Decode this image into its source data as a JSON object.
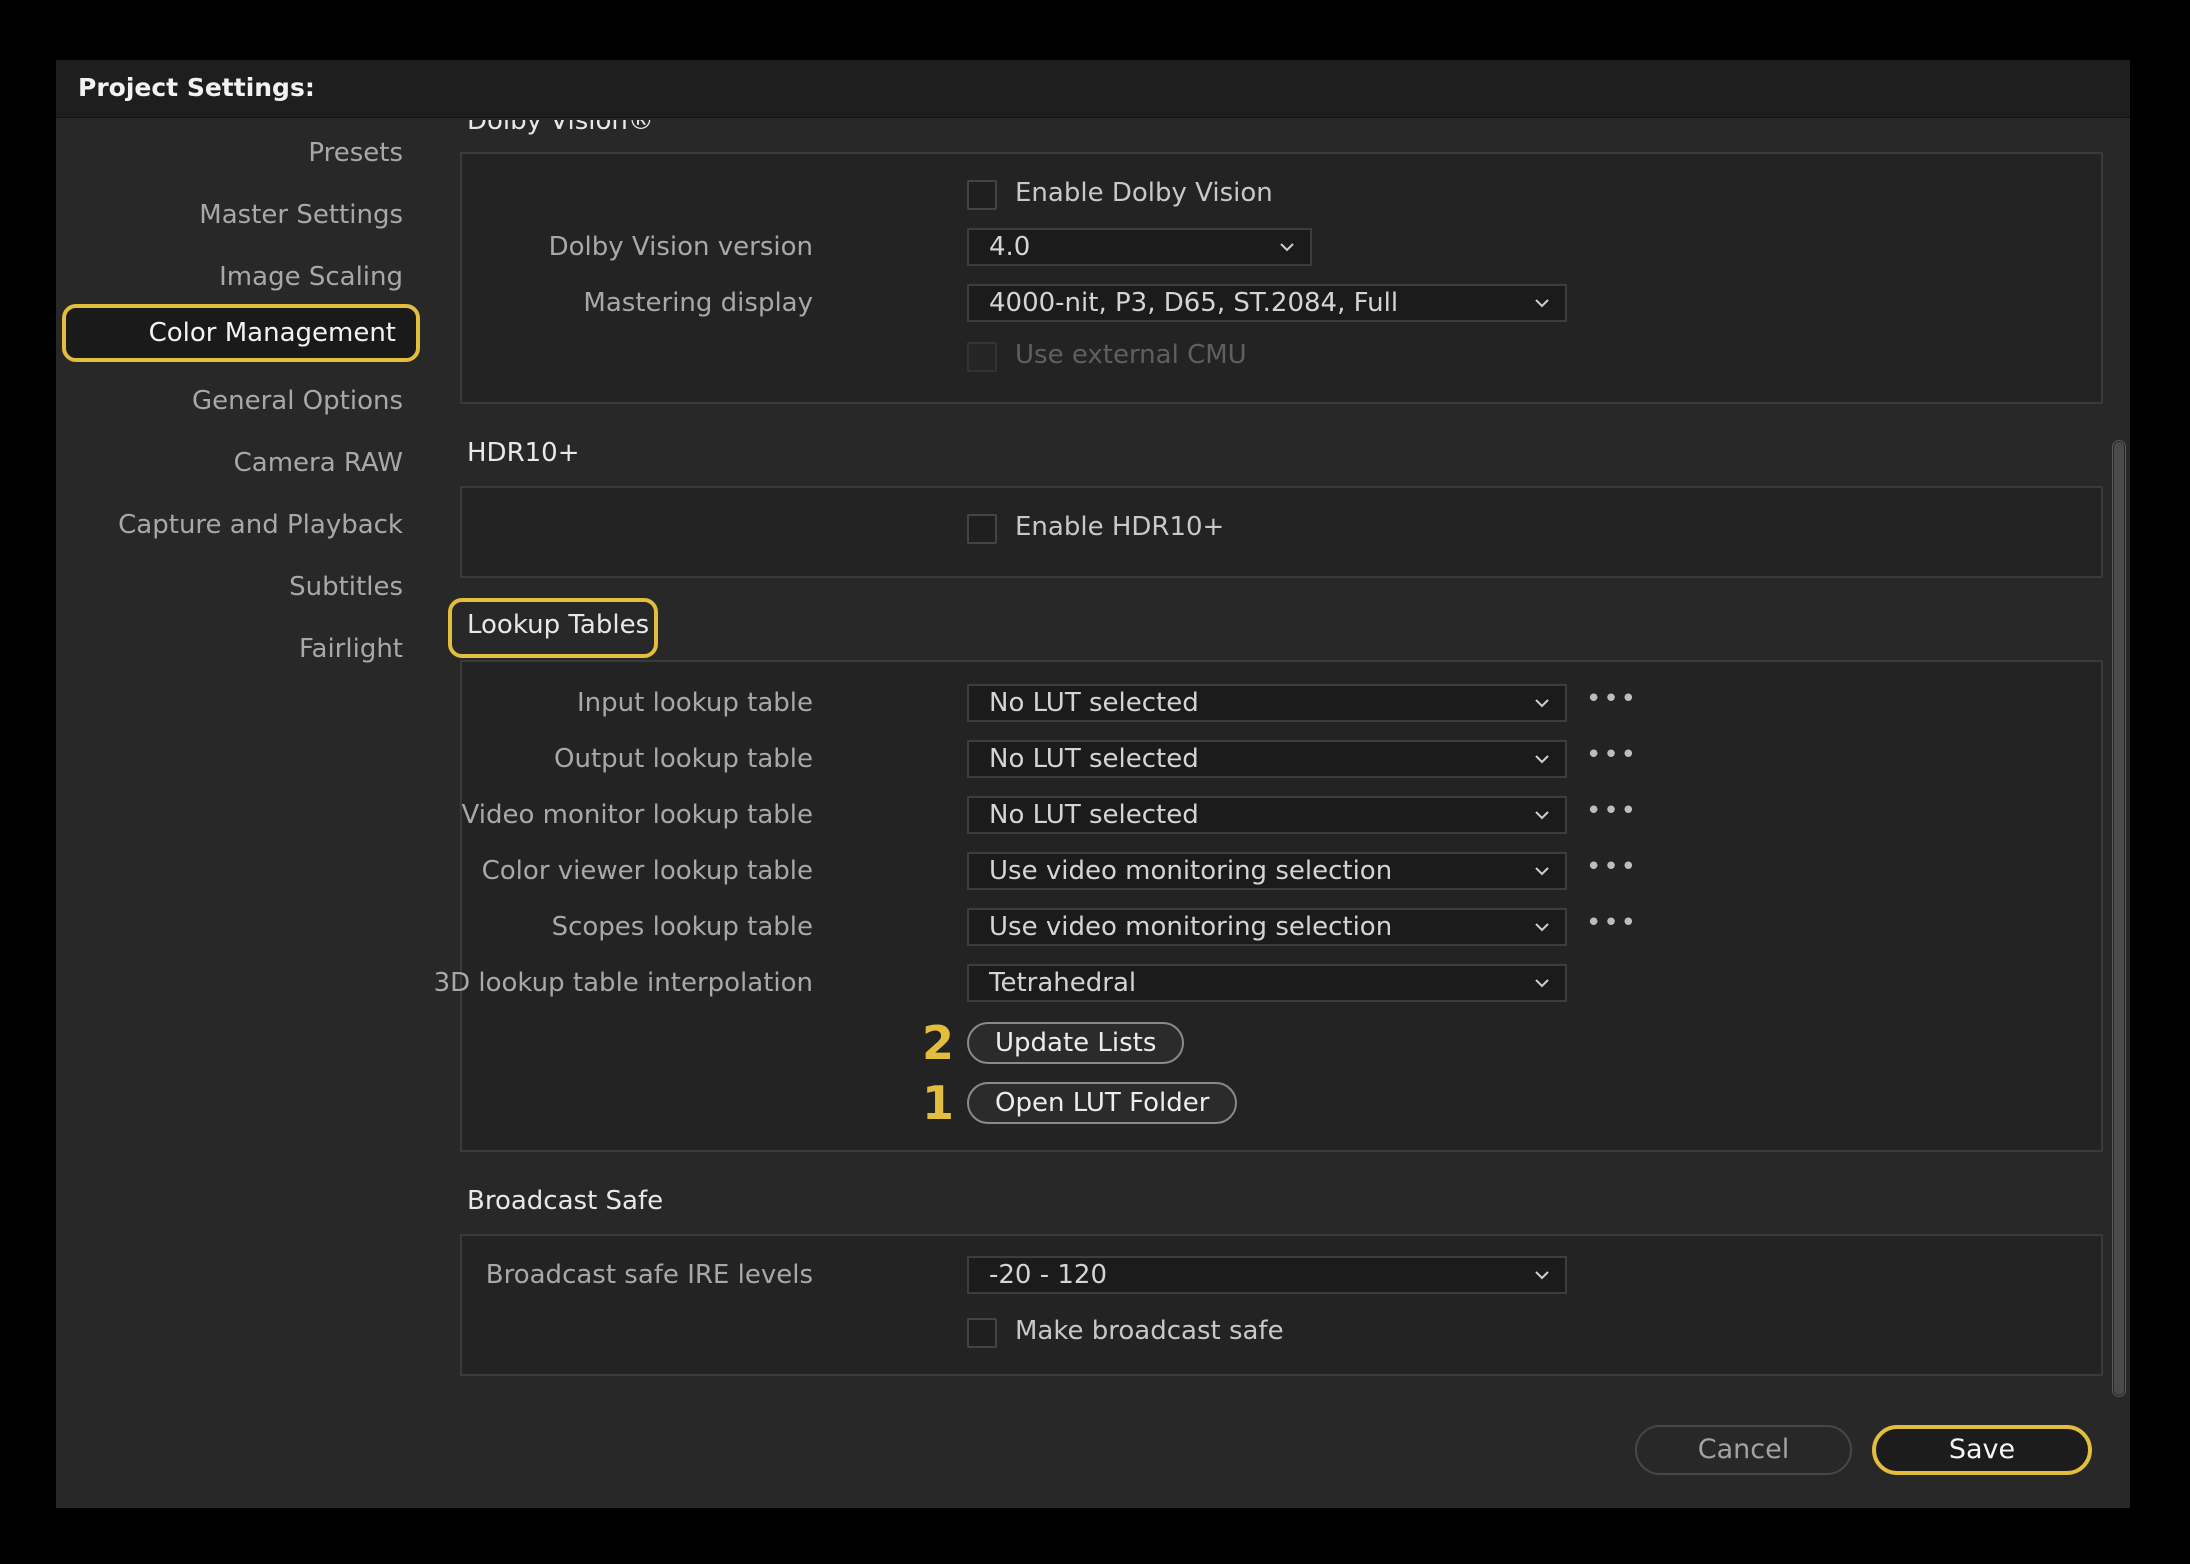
{
  "window": {
    "title": "Project Settings:"
  },
  "sidebar": {
    "items": [
      {
        "label": "Presets"
      },
      {
        "label": "Master Settings"
      },
      {
        "label": "Image Scaling"
      },
      {
        "label": "Color Management",
        "active": true
      },
      {
        "label": "General Options"
      },
      {
        "label": "Camera RAW"
      },
      {
        "label": "Capture and Playback"
      },
      {
        "label": "Subtitles"
      },
      {
        "label": "Fairlight"
      }
    ]
  },
  "dolby": {
    "title": "Dolby Vision®",
    "enable_label": "Enable Dolby Vision",
    "enable_checked": false,
    "version_label": "Dolby Vision version",
    "version_value": "4.0",
    "mastering_label": "Mastering display",
    "mastering_value": "4000-nit, P3, D65, ST.2084, Full",
    "external_cmu_label": "Use external CMU",
    "external_cmu_disabled": true
  },
  "hdr10": {
    "title": "HDR10+",
    "enable_label": "Enable HDR10+",
    "enable_checked": false
  },
  "lut": {
    "title": "Lookup Tables",
    "rows": [
      {
        "label": "Input lookup table",
        "value": "No LUT selected",
        "more": "•••"
      },
      {
        "label": "Output lookup table",
        "value": "No LUT selected",
        "more": "•••"
      },
      {
        "label": "Video monitor lookup table",
        "value": "No LUT selected",
        "more": "•••"
      },
      {
        "label": "Color viewer lookup table",
        "value": "Use video monitoring selection",
        "more": "•••"
      },
      {
        "label": "Scopes lookup table",
        "value": "Use video monitoring selection",
        "more": "•••"
      },
      {
        "label": "3D lookup table interpolation",
        "value": "Tetrahedral"
      }
    ],
    "update_button": "Update Lists",
    "update_marker": "2",
    "open_button": "Open LUT Folder",
    "open_marker": "1"
  },
  "broadcast": {
    "title": "Broadcast Safe",
    "ire_label": "Broadcast safe IRE levels",
    "ire_value": "-20 - 120",
    "make_safe_label": "Make broadcast safe",
    "make_safe_checked": false
  },
  "footer": {
    "cancel_label": "Cancel",
    "save_label": "Save"
  },
  "colors": {
    "highlight": "#e3bd3d",
    "background": "#282828",
    "panel": "#232323"
  }
}
